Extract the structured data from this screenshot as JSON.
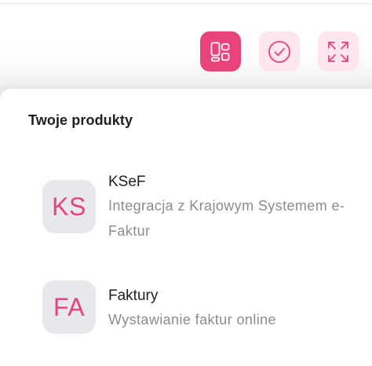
{
  "colors": {
    "accent": "#e8437a",
    "accent_soft": "#fde6ee",
    "tile_bg": "#e6e8ec",
    "text_primary": "#1f1f22",
    "text_secondary": "#8c8c91"
  },
  "toolbar": {
    "buttons": [
      {
        "icon": "products-grid-icon",
        "active": true
      },
      {
        "icon": "check-circle-icon",
        "active": false
      },
      {
        "icon": "expand-icon",
        "active": false
      }
    ]
  },
  "panel": {
    "title": "Twoje produkty",
    "products": [
      {
        "abbr": "KS",
        "name": "KSeF",
        "description": "Integracja z Krajowym Systemem e-Faktur"
      },
      {
        "abbr": "FA",
        "name": "Faktury",
        "description": "Wystawianie faktur online"
      }
    ]
  }
}
